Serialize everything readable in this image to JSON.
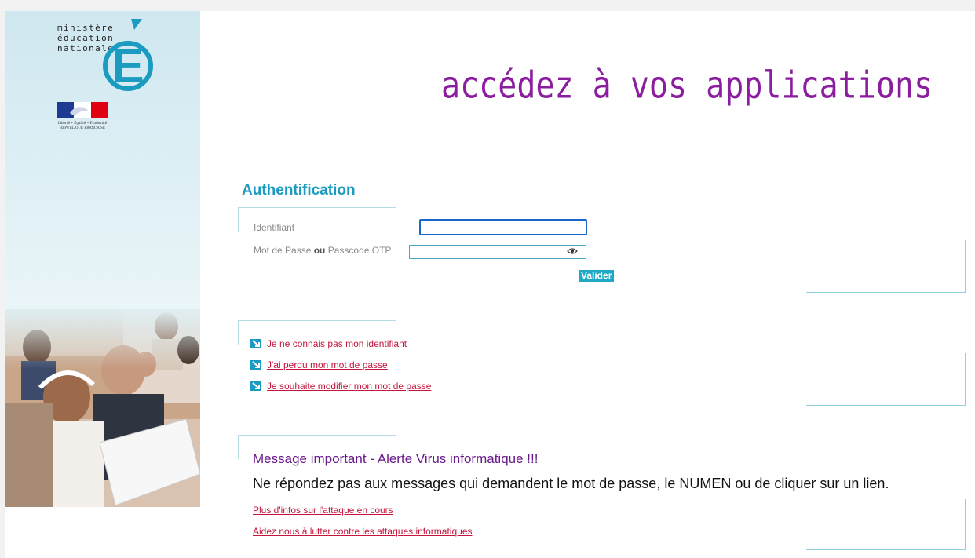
{
  "branding": {
    "ministere_lines": [
      "ministère",
      "éducation",
      "nationale"
    ],
    "logo_letter": "É",
    "marianne_motto": "Liberté • Égalité • Fraternité",
    "marianne_country": "RÉPUBLIQUE FRANÇAISE"
  },
  "header": {
    "title": "accédez à vos applications"
  },
  "auth": {
    "title": "Authentification",
    "identifiant_label": "Identifiant",
    "identifiant_value": "",
    "password_label_part1": "Mot de Passe ",
    "password_label_bold": "ou",
    "password_label_part2": " Passcode OTP",
    "password_value": "",
    "submit_label": "Valider"
  },
  "help_links": [
    "Je ne connais pas mon identifiant",
    "J'ai perdu mon mot de passe",
    "Je souhaite modifier mon mot de passe"
  ],
  "message": {
    "title": "Message important - Alerte Virus informatique !!!",
    "body": "Ne répondez pas aux messages qui demandent le mot de passe, le NUMEN ou de cliquer sur un lien.",
    "links": [
      "Plus d'infos sur l'attaque en cours",
      "Aidez nous à lutter contre les attaques informatiques"
    ]
  },
  "colors": {
    "title_purple": "#8a1e9e",
    "auth_blue": "#1a9bbf",
    "link_red": "#c4163d",
    "button_cyan": "#1fa9c4"
  }
}
